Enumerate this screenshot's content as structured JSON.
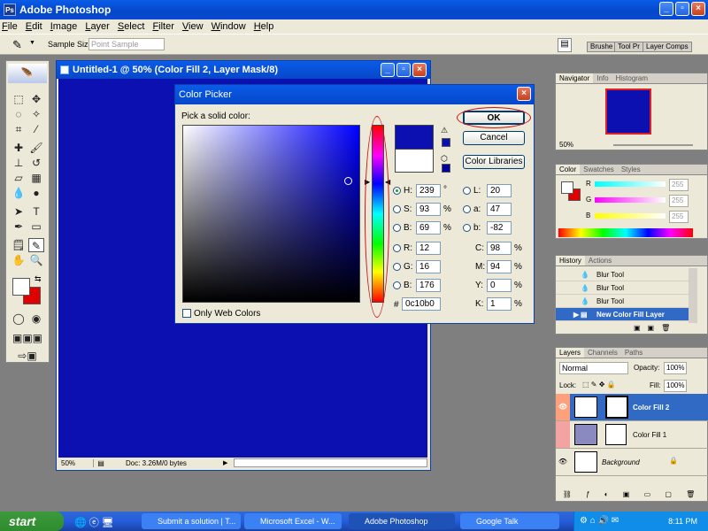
{
  "app": {
    "title": "Adobe Photoshop",
    "icon": "photoshop-icon"
  },
  "menu": [
    "File",
    "Edit",
    "Image",
    "Layer",
    "Select",
    "Filter",
    "View",
    "Window",
    "Help"
  ],
  "options": {
    "sample_size_label": "Sample Size:",
    "sample_size_value": "Point Sample",
    "palette_tabs": [
      "Brushes",
      "Tool Presets",
      "Layer Comps"
    ],
    "palette_tabs_shown": [
      "Brushe",
      "Tool Pr",
      "Layer Comps"
    ]
  },
  "document": {
    "title": "Untitled-1 @ 50% (Color Fill 2, Layer Mask/8)",
    "zoom": "50%",
    "doc_info": "Doc: 3.26M/0 bytes",
    "fill_color": "#0c10b0"
  },
  "color_picker": {
    "title": "Color Picker",
    "pick_label": "Pick a solid color:",
    "ok": "OK",
    "cancel": "Cancel",
    "libraries": "Color Libraries",
    "web_colors": "Only Web Colors",
    "H": "239",
    "H_unit": "°",
    "S": "93",
    "S_unit": "%",
    "B": "69",
    "B_unit": "%",
    "R": "12",
    "G": "16",
    "Bv": "176",
    "L": "20",
    "a": "47",
    "b": "-82",
    "C": "98",
    "M": "94",
    "Y": "0",
    "K": "1",
    "pct": "%",
    "hex_label": "#",
    "hex": "0c10b0",
    "labels": {
      "H": "H:",
      "S": "S:",
      "B": "B:",
      "R": "R:",
      "G": "G:",
      "Bl": "B:",
      "L": "L:",
      "a": "a:",
      "b": "b:",
      "C": "C:",
      "M": "M:",
      "Y": "Y:",
      "K": "K:"
    }
  },
  "navigator": {
    "tabs": [
      "Navigator",
      "Info",
      "Histogram"
    ],
    "zoom": "50%"
  },
  "color_panel": {
    "tabs": [
      "Color",
      "Swatches",
      "Styles"
    ],
    "labels": [
      "R",
      "G",
      "B"
    ],
    "values": [
      "255",
      "255",
      "255"
    ]
  },
  "history": {
    "tabs": [
      "History",
      "Actions"
    ],
    "items": [
      "Blur Tool",
      "Blur Tool",
      "Blur Tool",
      "New Color Fill Layer"
    ]
  },
  "layers": {
    "tabs": [
      "Layers",
      "Channels",
      "Paths"
    ],
    "blend": "Normal",
    "opacity_label": "Opacity:",
    "opacity": "100%",
    "lock_label": "Lock:",
    "fill_label": "Fill:",
    "fill": "100%",
    "items": [
      "Color Fill 2",
      "Color Fill 1",
      "Background"
    ]
  },
  "taskbar": {
    "start": "start",
    "tasks": [
      "Submit a solution | T...",
      "Microsoft Excel - W...",
      "Adobe Photoshop",
      "Google Talk"
    ],
    "time": "8:11 PM"
  }
}
